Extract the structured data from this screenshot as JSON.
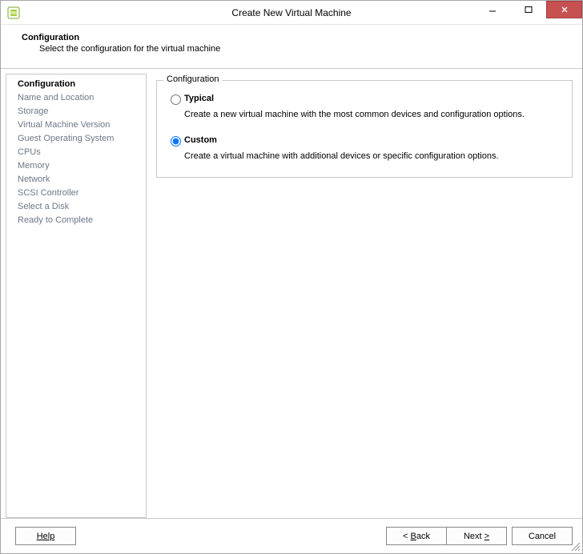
{
  "titlebar": {
    "title": "Create New Virtual Machine"
  },
  "header": {
    "title": "Configuration",
    "subtitle": "Select the configuration for the virtual machine"
  },
  "sidebar": {
    "items": [
      {
        "label": "Configuration",
        "active": true
      },
      {
        "label": "Name and Location"
      },
      {
        "label": "Storage"
      },
      {
        "label": "Virtual Machine Version"
      },
      {
        "label": "Guest Operating System"
      },
      {
        "label": "CPUs"
      },
      {
        "label": "Memory"
      },
      {
        "label": "Network"
      },
      {
        "label": "SCSI Controller"
      },
      {
        "label": "Select a Disk"
      },
      {
        "label": "Ready to Complete"
      }
    ]
  },
  "groupbox": {
    "title": "Configuration",
    "options": {
      "typical": {
        "label": "Typical",
        "desc": "Create a new virtual machine with the most common devices and configuration options."
      },
      "custom": {
        "label": "Custom",
        "desc": "Create a virtual machine with additional devices or specific configuration options."
      }
    }
  },
  "buttons": {
    "help": "Help",
    "back_prefix": "<",
    "back_u": "B",
    "back_suffix": "ack",
    "next_prefix": "Next",
    "next_u": ">",
    "cancel": "Cancel"
  }
}
